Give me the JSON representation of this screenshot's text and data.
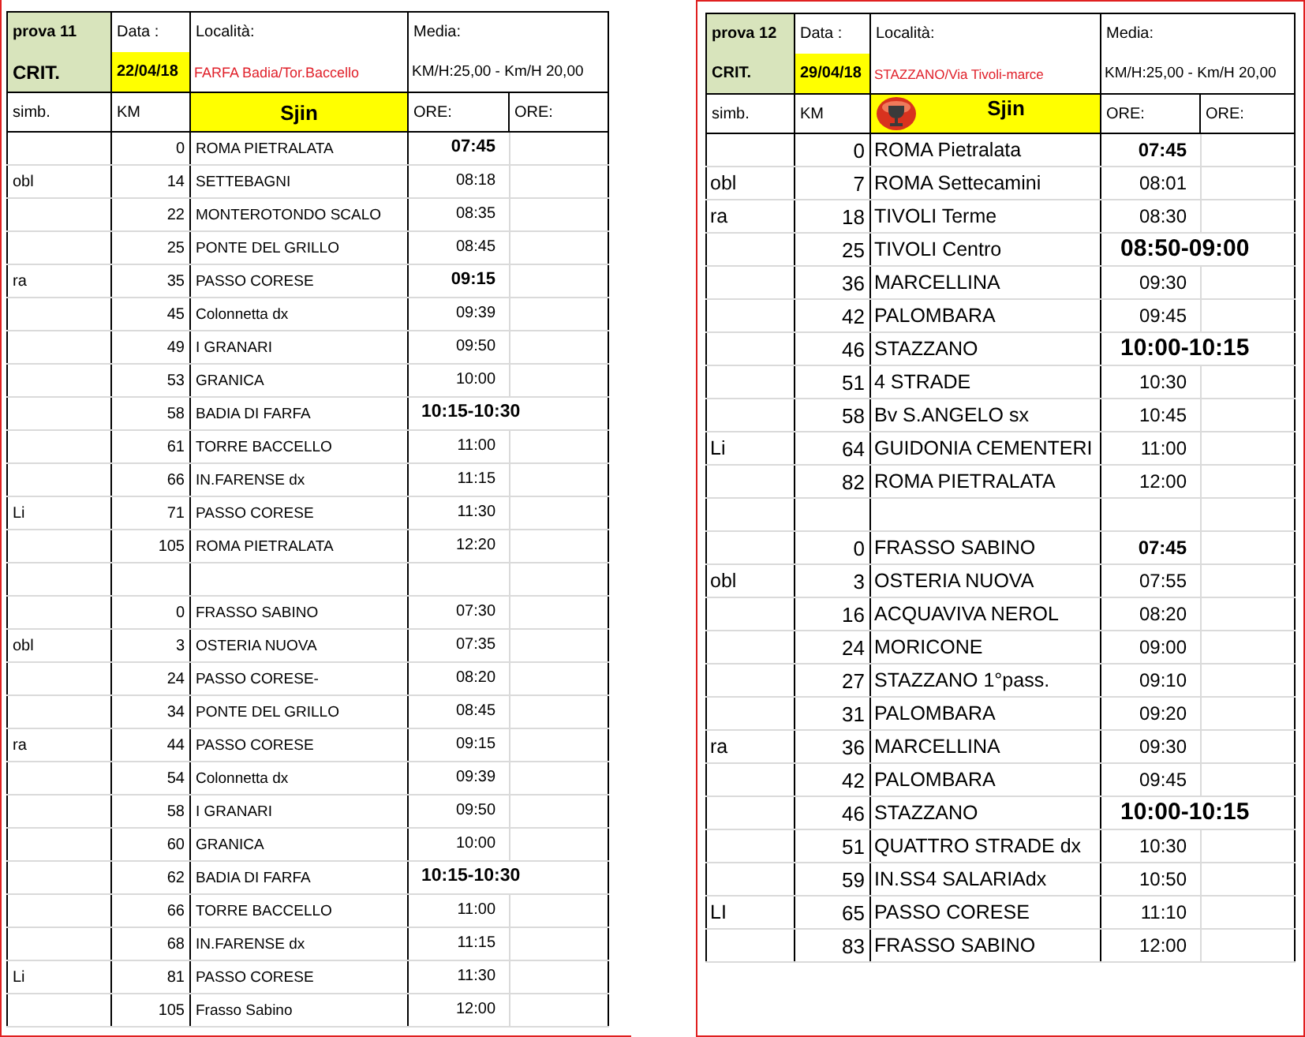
{
  "sheets": [
    {
      "title": "prova 11",
      "data_label": "Data :",
      "location_label": "Località:",
      "media_label": "Media:",
      "crit": "CRIT.",
      "date": "22/04/18",
      "location": "FARFA Badia/Tor.Baccello",
      "media": "KM/H:25,00 - Km/H 20,00",
      "trophy": false,
      "columns": [
        "simb.",
        "KM",
        "Sjin",
        "ORE:",
        "ORE:"
      ],
      "rows": [
        {
          "km": "0",
          "place": "ROMA PIETRALATA",
          "time": "07:45",
          "kind": "bold"
        },
        {
          "simb": "obl",
          "km": "14",
          "place": "SETTEBAGNI",
          "time": "08:18",
          "kind": "plain"
        },
        {
          "km": "22",
          "place": "MONTEROTONDO SCALO",
          "time": "08:35",
          "kind": "plain"
        },
        {
          "km": "25",
          "place": "PONTE DEL GRILLO",
          "time": "08:45",
          "kind": "plain"
        },
        {
          "simb": "ra",
          "km": "35",
          "place": "PASSO CORESE",
          "time": "09:15",
          "kind": "bold"
        },
        {
          "km": "45",
          "place": "Colonnetta  dx",
          "time": "09:39",
          "kind": "plain"
        },
        {
          "km": "49",
          "place": "I GRANARI",
          "time": "09:50",
          "kind": "plain"
        },
        {
          "km": "53",
          "place": "GRANICA",
          "time": "10:00",
          "kind": "plain"
        },
        {
          "km": "58",
          "place": "BADIA DI FARFA",
          "time": "10:15-10:30",
          "kind": "big"
        },
        {
          "km": "61",
          "place": "TORRE BACCELLO",
          "time": "11:00",
          "kind": "plain"
        },
        {
          "km": "66",
          "place": "IN.FARENSE dx",
          "time": "11:15",
          "kind": "plain"
        },
        {
          "simb": "Li",
          "km": "71",
          "place": "PASSO CORESE",
          "time": "11:30",
          "kind": "plain"
        },
        {
          "km": "105",
          "place": "ROMA PIETRALATA",
          "time": "12:20",
          "kind": "plain"
        },
        {
          "kind": "blank"
        },
        {
          "km": "0",
          "place": "FRASSO SABINO",
          "time": "07:30",
          "kind": "plain"
        },
        {
          "simb": "obl",
          "km": "3",
          "place": "OSTERIA NUOVA",
          "time": "07:35",
          "kind": "plain"
        },
        {
          "km": "24",
          "place": "PASSO CORESE-",
          "time": "08:20",
          "kind": "plain"
        },
        {
          "km": "34",
          "place": "PONTE DEL GRILLO",
          "time": "08:45",
          "kind": "plain"
        },
        {
          "simb": "ra",
          "km": "44",
          "place": "PASSO CORESE",
          "time": "09:15",
          "kind": "plain"
        },
        {
          "km": "54",
          "place": "Colonnetta  dx",
          "time": "09:39",
          "kind": "plain"
        },
        {
          "km": "58",
          "place": "I GRANARI",
          "time": "09:50",
          "kind": "plain"
        },
        {
          "km": "60",
          "place": "GRANICA",
          "time": "10:00",
          "kind": "plain"
        },
        {
          "km": "62",
          "place": "BADIA DI FARFA",
          "time": "10:15-10:30",
          "kind": "big"
        },
        {
          "km": "66",
          "place": "TORRE BACCELLO",
          "time": "11:00",
          "kind": "plain"
        },
        {
          "km": "68",
          "place": "IN.FARENSE dx",
          "time": "11:15",
          "kind": "plain"
        },
        {
          "simb": "Li",
          "km": "81",
          "place": "PASSO CORESE",
          "time": "11:30",
          "kind": "plain"
        },
        {
          "km": "105",
          "place": "Frasso Sabino",
          "time": "12:00",
          "kind": "plain"
        }
      ]
    },
    {
      "title": "prova 12",
      "data_label": "Data :",
      "location_label": "Località:",
      "media_label": "Media:",
      "crit": "CRIT.",
      "date": "29/04/18",
      "location": "STAZZANO/Via Tivoli-marce",
      "media": "KM/H:25,00 - Km/H 20,00",
      "trophy": true,
      "columns": [
        "simb.",
        "KM",
        "Sjin",
        "ORE:",
        "ORE:"
      ],
      "rows": [
        {
          "km": "0",
          "place": "ROMA Pietralata",
          "time": "07:45",
          "kind": "bold"
        },
        {
          "simb": "obl",
          "km": "7",
          "place": "ROMA Settecamini",
          "time": "08:01",
          "kind": "plain"
        },
        {
          "simb": "ra",
          "km": "18",
          "place": "TIVOLI Terme",
          "time": "08:30",
          "kind": "plain"
        },
        {
          "km": "25",
          "place": "TIVOLI Centro",
          "time": "08:50-09:00",
          "kind": "big"
        },
        {
          "km": "36",
          "place": "MARCELLINA",
          "time": "09:30",
          "kind": "plain"
        },
        {
          "km": "42",
          "place": "PALOMBARA",
          "time": "09:45",
          "kind": "plain"
        },
        {
          "km": "46",
          "place": "STAZZANO",
          "time": "10:00-10:15",
          "kind": "big"
        },
        {
          "km": "51",
          "place": "4 STRADE",
          "time": "10:30",
          "kind": "plain"
        },
        {
          "km": "58",
          "place": "Bv S.ANGELO sx",
          "time": "10:45",
          "kind": "plain"
        },
        {
          "simb": "Li",
          "km": "64",
          "place": "GUIDONIA CEMENTERI",
          "time": "11:00",
          "kind": "plain"
        },
        {
          "km": "82",
          "place": "ROMA PIETRALATA",
          "time": "12:00",
          "kind": "plain"
        },
        {
          "kind": "blank"
        },
        {
          "km": "0",
          "place": "FRASSO SABINO",
          "time": "07:45",
          "kind": "bold"
        },
        {
          "simb": "obl",
          "km": "3",
          "place": "OSTERIA NUOVA",
          "time": "07:55",
          "kind": "plain"
        },
        {
          "km": "16",
          "place": "ACQUAVIVA NEROL",
          "time": "08:20",
          "kind": "plain"
        },
        {
          "km": "24",
          "place": "MORICONE",
          "time": "09:00",
          "kind": "plain"
        },
        {
          "km": "27",
          "place": "STAZZANO 1°pass.",
          "time": "09:10",
          "kind": "plain"
        },
        {
          "km": "31",
          "place": "PALOMBARA",
          "time": "09:20",
          "kind": "plain"
        },
        {
          "simb": "ra",
          "km": "36",
          "place": "MARCELLINA",
          "time": "09:30",
          "kind": "plain"
        },
        {
          "km": "42",
          "place": "PALOMBARA",
          "time": "09:45",
          "kind": "plain"
        },
        {
          "km": "46",
          "place": "STAZZANO",
          "time": "10:00-10:15",
          "kind": "big"
        },
        {
          "km": "51",
          "place": "QUATTRO STRADE dx",
          "time": "10:30",
          "kind": "plain"
        },
        {
          "km": "59",
          "place": "IN.SS4 SALARIAdx",
          "time": "10:50",
          "kind": "plain"
        },
        {
          "simb": "LI",
          "km": "65",
          "place": "PASSO CORESE",
          "time": "11:10",
          "kind": "plain"
        },
        {
          "km": "83",
          "place": "FRASSO SABINO",
          "time": "12:00",
          "kind": "plain"
        }
      ]
    }
  ]
}
